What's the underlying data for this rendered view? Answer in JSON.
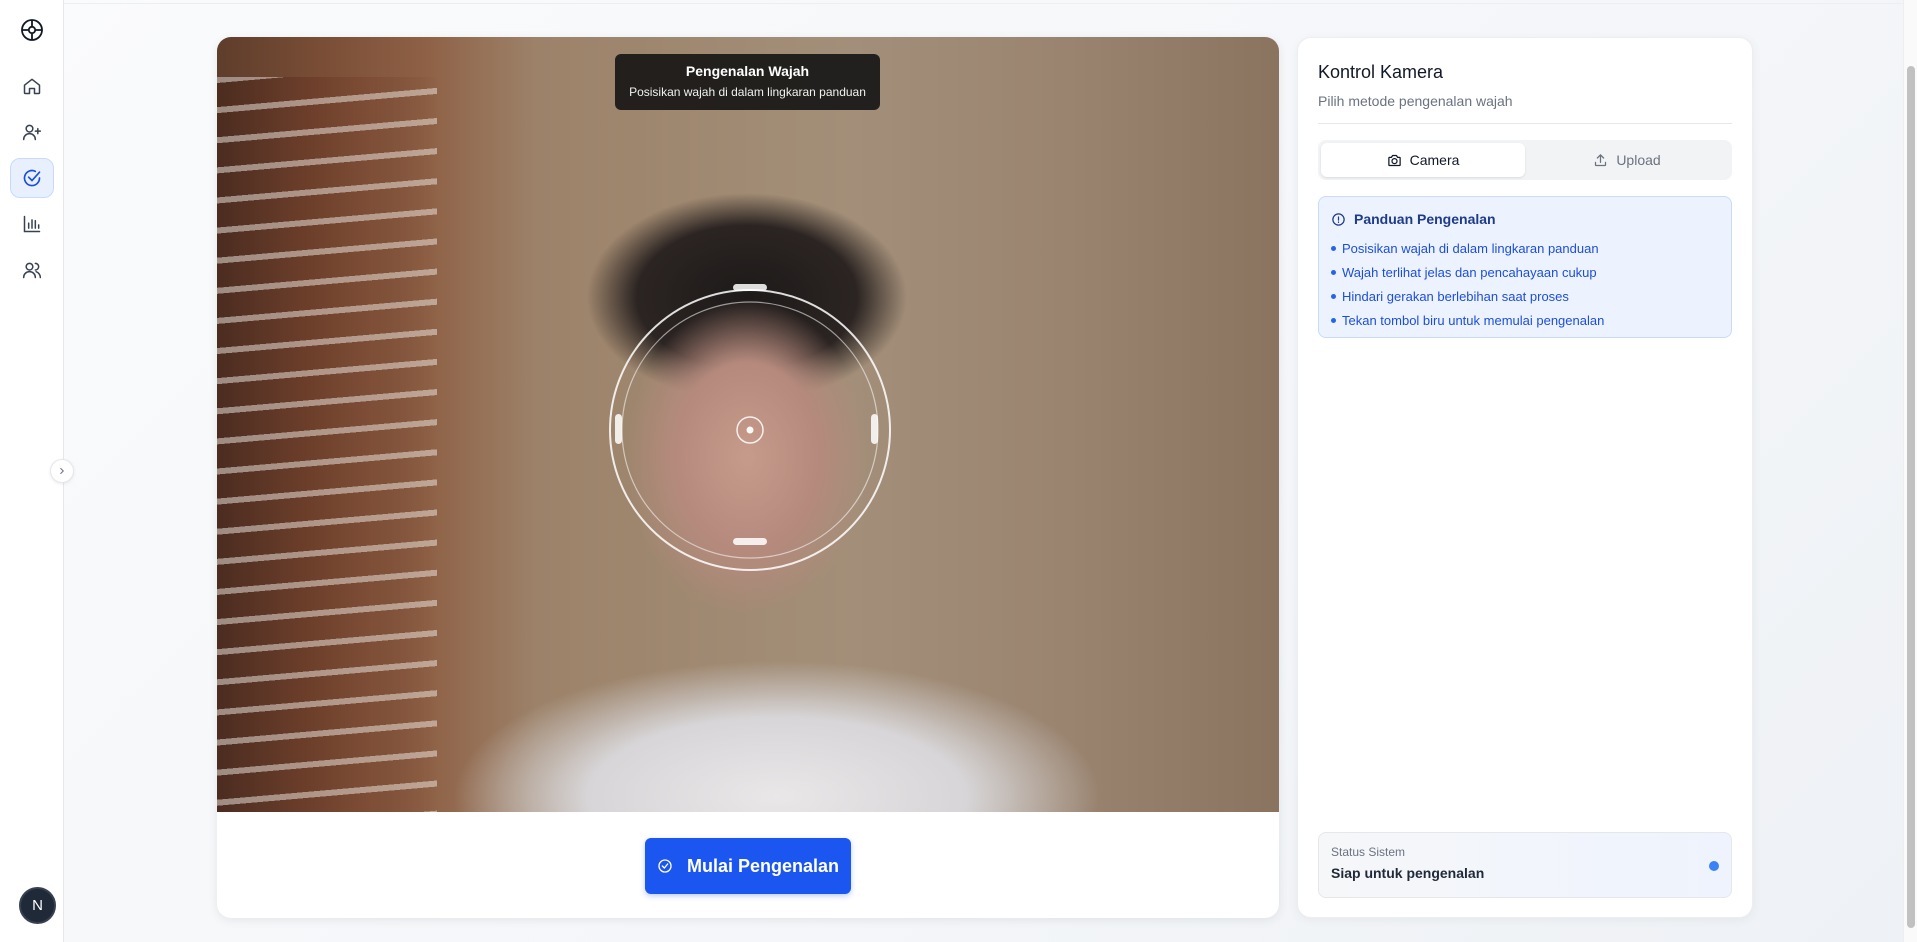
{
  "sidebar": {
    "logo_icon": "aperture-icon",
    "items": [
      {
        "name": "home",
        "icon": "home-icon",
        "active": false
      },
      {
        "name": "register",
        "icon": "user-plus-icon",
        "active": false
      },
      {
        "name": "recognize",
        "icon": "check-circle-icon",
        "active": true
      },
      {
        "name": "reports",
        "icon": "bar-chart-icon",
        "active": false
      },
      {
        "name": "users",
        "icon": "users-icon",
        "active": false
      }
    ],
    "avatar_initial": "N"
  },
  "camera": {
    "tooltip_title": "Pengenalan Wajah",
    "tooltip_subtitle": "Posisikan wajah di dalam lingkaran panduan",
    "start_button_label": "Mulai Pengenalan"
  },
  "panel": {
    "title": "Kontrol Kamera",
    "subtitle": "Pilih metode pengenalan wajah",
    "tabs": [
      {
        "label": "Camera",
        "icon": "camera-icon",
        "active": true
      },
      {
        "label": "Upload",
        "icon": "upload-icon",
        "active": false
      }
    ],
    "guide": {
      "title": "Panduan Pengenalan",
      "items": [
        "Posisikan wajah di dalam lingkaran panduan",
        "Wajah terlihat jelas dan pencahayaan cukup",
        "Hindari gerakan berlebihan saat proses",
        "Tekan tombol biru untuk memulai pengenalan"
      ]
    },
    "status": {
      "label": "Status Sistem",
      "value": "Siap untuk pengenalan"
    }
  },
  "colors": {
    "accent": "#1b56f0",
    "info_bg": "#ecf3ff",
    "status_dot": "#3b82f6"
  }
}
